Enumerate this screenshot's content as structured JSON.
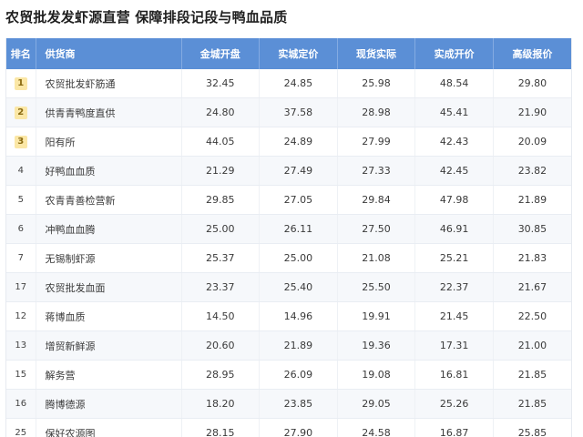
{
  "title": "农贸批发发虾源直营 保障排段记段与鸭血品质",
  "table": {
    "headers": [
      "排名",
      "供货商",
      "金城开盘",
      "实城定价",
      "现货实际",
      "实成开价",
      "高级报价"
    ],
    "rows": [
      {
        "rank": "1",
        "name": "农贸批发虾筋通",
        "v": [
          "32.45",
          "24.85",
          "25.98",
          "48.54",
          "29.80"
        ]
      },
      {
        "rank": "2",
        "name": "供青青鸭度直供",
        "v": [
          "24.80",
          "37.58",
          "28.98",
          "45.41",
          "21.90"
        ]
      },
      {
        "rank": "3",
        "name": "阳有所",
        "v": [
          "44.05",
          "24.89",
          "27.99",
          "42.43",
          "20.09"
        ]
      },
      {
        "rank": "4",
        "name": "好鸭血血质",
        "v": [
          "21.29",
          "27.49",
          "27.33",
          "42.45",
          "23.82"
        ]
      },
      {
        "rank": "5",
        "name": "农青青善检营新",
        "v": [
          "29.85",
          "27.05",
          "29.84",
          "47.98",
          "21.89"
        ]
      },
      {
        "rank": "6",
        "name": "冲鸭血血腾",
        "v": [
          "25.00",
          "26.11",
          "27.50",
          "46.91",
          "30.85"
        ]
      },
      {
        "rank": "7",
        "name": "无锡制虾源",
        "v": [
          "25.37",
          "25.00",
          "21.08",
          "25.21",
          "21.83"
        ]
      },
      {
        "rank": "17",
        "name": "农贸批发血面",
        "v": [
          "23.37",
          "25.40",
          "25.50",
          "22.37",
          "21.67"
        ]
      },
      {
        "rank": "12",
        "name": "蒋博血质",
        "v": [
          "14.50",
          "14.96",
          "19.91",
          "21.45",
          "22.50"
        ]
      },
      {
        "rank": "13",
        "name": "增贸新鲜源",
        "v": [
          "20.60",
          "21.89",
          "19.36",
          "17.31",
          "21.00"
        ]
      },
      {
        "rank": "15",
        "name": "解务营",
        "v": [
          "28.95",
          "26.09",
          "19.08",
          "16.81",
          "21.85"
        ]
      },
      {
        "rank": "16",
        "name": "腾博德源",
        "v": [
          "18.20",
          "23.85",
          "29.05",
          "25.26",
          "21.85"
        ]
      },
      {
        "rank": "25",
        "name": "保好农源图",
        "v": [
          "28.15",
          "27.90",
          "24.58",
          "16.87",
          "25.85"
        ]
      }
    ]
  },
  "colors": {
    "header_bg": "#5b8fd6",
    "top_rank_badge": "#fbe7a6"
  }
}
